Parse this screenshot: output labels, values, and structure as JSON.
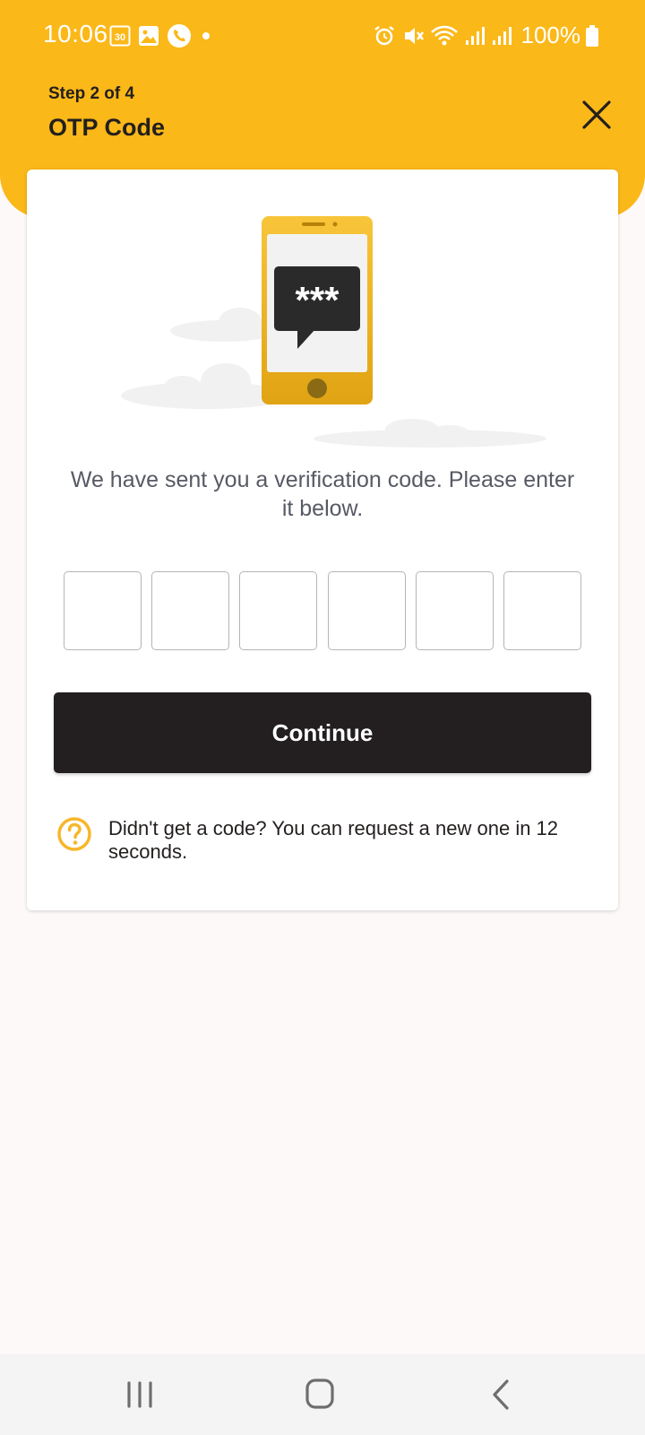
{
  "status_bar": {
    "time": "10:06",
    "calendar_badge": "30",
    "battery": "100%"
  },
  "header": {
    "step": "Step 2 of 4",
    "title": "OTP Code"
  },
  "illustration": {
    "bubble_text": "***"
  },
  "main": {
    "message": "We have sent you a verification code. Please enter it below.",
    "otp_digits": [
      "",
      "",
      "",
      "",
      "",
      ""
    ],
    "continue_label": "Continue",
    "help_text": "Didn't get a code? You can request a new one in 12 seconds."
  },
  "colors": {
    "brand_yellow": "#fbb819",
    "button_dark": "#231f20",
    "background": "#fdf9f8"
  }
}
